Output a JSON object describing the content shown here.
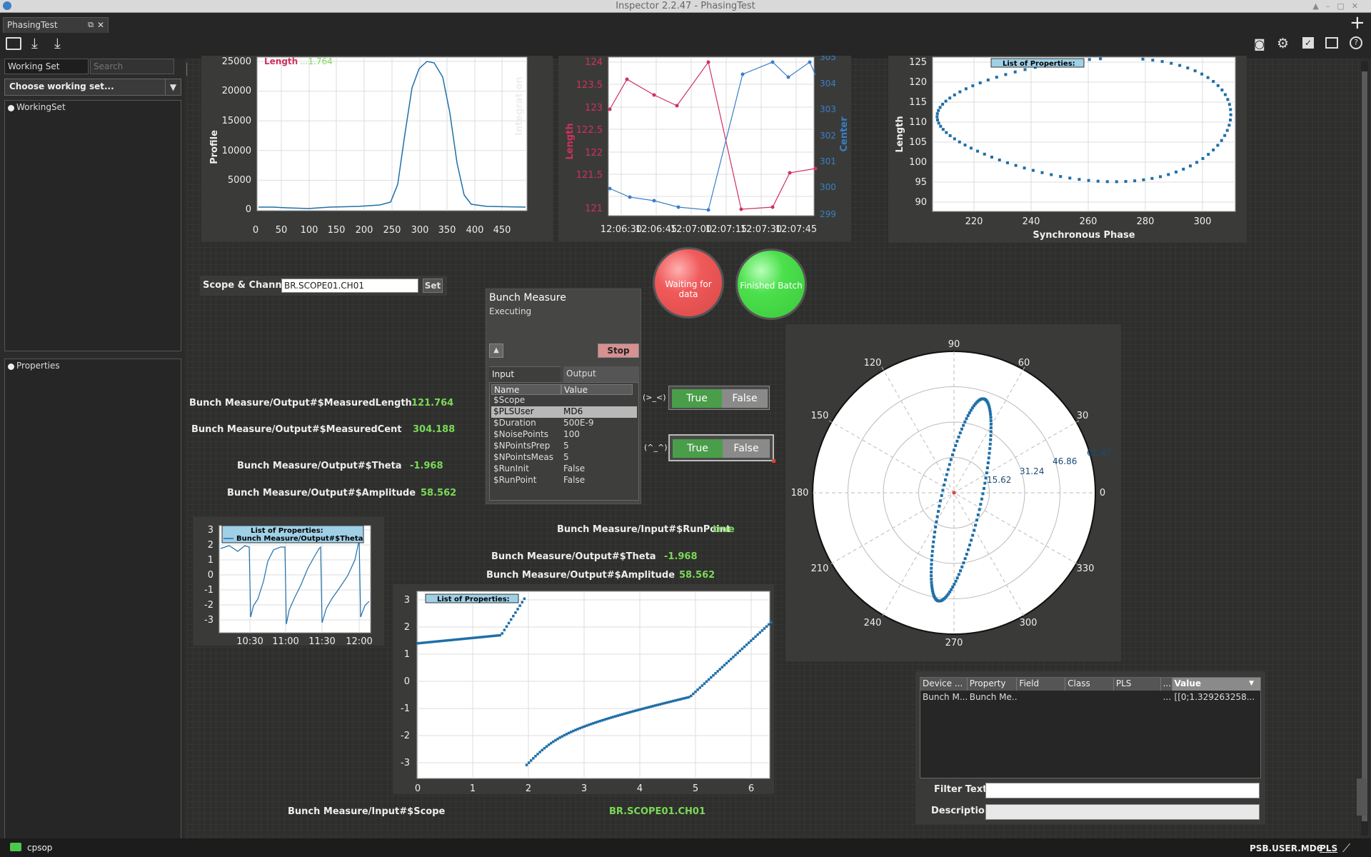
{
  "window": {
    "title": "Inspector 2.2.47 - PhasingTest"
  },
  "tab": {
    "label": "PhasingTest"
  },
  "sidebar": {
    "working_set_field": "Working Set",
    "search_placeholder": "Search",
    "choose_working_set": "Choose working set...",
    "tree_root": "WorkingSet",
    "properties_root": "Properties"
  },
  "profile_chart": {
    "ylabel": "Profile",
    "legend_label": "Length",
    "legend_value": "...1.764",
    "yticks": [
      "25000",
      "20000",
      "15000",
      "10000",
      "5000",
      "0"
    ],
    "xticks": [
      "0",
      "50",
      "100",
      "150",
      "200",
      "250",
      "300",
      "350",
      "400",
      "450"
    ]
  },
  "integration_chart": {
    "side_label": "Integration",
    "ylabel_left": "Length",
    "ylabel_right": "Center",
    "yticks_left": [
      "124",
      "123.5",
      "123",
      "122.5",
      "122",
      "121.5",
      "121"
    ],
    "yticks_right": [
      "305",
      "304",
      "303",
      "302",
      "301",
      "300",
      "299"
    ],
    "xticks": [
      "12:06:30",
      "12:06:45",
      "12:07:00",
      "12:07:15",
      "12:07:30",
      "12:07:45"
    ]
  },
  "phase_chart": {
    "ylabel": "Length",
    "xlabel": "Synchronous Phase",
    "legend": "List of Properties:",
    "yticks": [
      "125",
      "120",
      "115",
      "110",
      "105",
      "100",
      "95",
      "90"
    ],
    "xticks": [
      "220",
      "240",
      "260",
      "280",
      "300"
    ]
  },
  "scope": {
    "label": "Scope & Channel",
    "value": "BR.SCOPE01.CH01",
    "set_button": "Set"
  },
  "leds": {
    "waiting": "Waiting for data",
    "finished": "Finished Batch"
  },
  "bunch_measure": {
    "title": "Bunch Measure",
    "status": "Executing",
    "stop": "Stop",
    "tab_input": "Input",
    "tab_output": "Output",
    "col_name": "Name",
    "col_value": "Value",
    "rows": [
      {
        "name": "$Scope",
        "value": ""
      },
      {
        "name": "$PLSUser",
        "value": "MD6"
      },
      {
        "name": "$Duration",
        "value": "500E-9"
      },
      {
        "name": "$NoisePoints",
        "value": "100"
      },
      {
        "name": "$NPointsPrep",
        "value": "5"
      },
      {
        "name": "$NPointsMeas",
        "value": "5"
      },
      {
        "name": "$RunInit",
        "value": "False"
      },
      {
        "name": "$RunPoint",
        "value": "False"
      }
    ]
  },
  "toggles": [
    {
      "label": "(>_<)",
      "true": "True",
      "false": "False",
      "selected": "True"
    },
    {
      "label": "(^_^)",
      "true": "True",
      "false": "False",
      "selected": "True"
    }
  ],
  "outputs": {
    "measured_length_label": "Bunch Measure/Output#$MeasuredLength",
    "measured_length_value": "121.764",
    "measured_center_label": "Bunch Measure/Output#$MeasuredCent",
    "measured_center_value": "304.188",
    "theta_label": "Bunch Measure/Output#$Theta",
    "theta_value": "-1.968",
    "amplitude_label": "Bunch Measure/Output#$Amplitude",
    "amplitude_value": "58.562",
    "runpoint_label": "Bunch Measure/Input#$RunPoint",
    "runpoint_value": "true",
    "theta2_label": "Bunch Measure/Output#$Theta",
    "theta2_value": "-1.968",
    "amplitude2_label": "Bunch Measure/Output#$Amplitude",
    "amplitude2_value": "58.562",
    "scope_label": "Bunch Measure/Input#$Scope",
    "scope_value": "BR.SCOPE01.CH01"
  },
  "theta_chart": {
    "legend_title": "List of Properties:",
    "legend_series": "Bunch Measure/Output#$Theta",
    "yticks": [
      "3",
      "2",
      "1",
      "0",
      "-1",
      "-2",
      "-3"
    ],
    "xticks": [
      "10:30",
      "11:00",
      "11:30",
      "12:00"
    ]
  },
  "scatter_chart": {
    "legend": "List of Properties:",
    "yticks": [
      "3",
      "2",
      "1",
      "0",
      "-1",
      "-2",
      "-3"
    ],
    "xticks": [
      "0",
      "1",
      "2",
      "3",
      "4",
      "5",
      "6"
    ]
  },
  "polar_chart": {
    "angle_labels": [
      "90",
      "60",
      "30",
      "0",
      "330",
      "300",
      "270",
      "240",
      "210",
      "180",
      "150",
      "120"
    ],
    "radius_labels": [
      "15.62",
      "31.24",
      "46.86",
      "62.47"
    ]
  },
  "property_table": {
    "headers": [
      "Device ...",
      "Property",
      "Field",
      "Class",
      "PLS",
      "...",
      "Value"
    ],
    "row": [
      "Bunch M...",
      "Bunch Me...",
      "",
      "",
      "",
      "...",
      "[[0;1.329263258..."
    ],
    "filter_label": "Filter Text:",
    "description_label": "Description:"
  },
  "status": {
    "user": "cpsop",
    "pls": "PSB.USER.MD6",
    "pls_button": "PLS"
  },
  "colors": {
    "accent_green": "#7ad957",
    "series_blue": "#1f6fa8",
    "series_red": "#d03060",
    "led_red": "#f05a5a",
    "led_green": "#4ce04c"
  }
}
